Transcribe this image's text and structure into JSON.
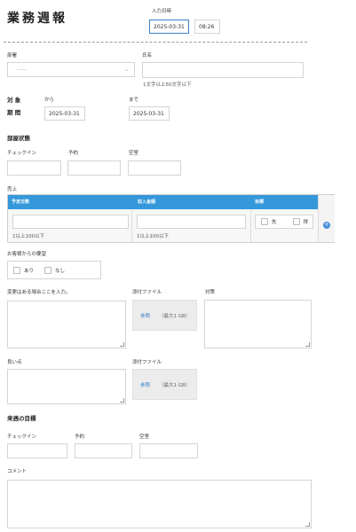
{
  "header": {
    "title": "業務週報",
    "input_datetime_label": "入力日時",
    "input_date": "2025-03-31",
    "input_time": "08:26"
  },
  "form": {
    "department_label": "部署",
    "department_value": "-----",
    "name_label": "氏名",
    "name_hint": "1文字以上50文字以下",
    "period_label_1": "対 象",
    "period_label_2": "期 間",
    "from_label": "から",
    "from_date": "2025-03-31",
    "to_label": "まで",
    "to_date": "2025-03-31",
    "room_status": {
      "title": "部屋状態",
      "checkin_label": "チェックイン",
      "reserved_label": "予約",
      "vacant_label": "空室"
    },
    "table": {
      "title": "売上",
      "col_plan": "予定日数",
      "col_income": "収入金額",
      "col_other": "目標",
      "plan_hint": "1以上100以下",
      "income_hint": "1以上100以下",
      "opt_a": "失",
      "opt_b": "得"
    },
    "requests": {
      "title": "お客様からの要望",
      "opt_yes": "あり",
      "opt_no": "なし"
    },
    "changes_label": "変更はある場合ここを入力。",
    "attach_label_1": "添付ファイル",
    "browse_1": "参照",
    "max_size_1": "（最大1 GB）",
    "response_label": "対策",
    "issues_label": "良い点",
    "attach_label_2": "添付ファイル",
    "browse_2": "参照",
    "max_size_2": "（最大1 GB）",
    "next_week": {
      "title": "来週の目標",
      "checkin_label": "チェックイン",
      "reserved_label": "予約",
      "vacant_label": "空室"
    },
    "comment_label": "コメント"
  },
  "colors": {
    "accent": "#3498db",
    "focus": "#3b82c4"
  }
}
